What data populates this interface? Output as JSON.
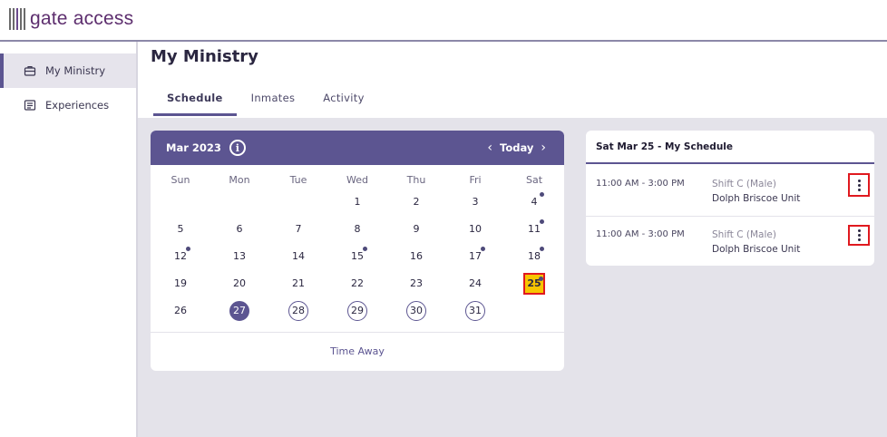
{
  "brand": {
    "name": "gate access"
  },
  "sidebar": {
    "items": [
      {
        "label": "My Ministry",
        "icon": "briefcase-icon",
        "active": true
      },
      {
        "label": "Experiences",
        "icon": "list-icon",
        "active": false
      }
    ]
  },
  "page": {
    "title": "My Ministry"
  },
  "tabs": [
    {
      "label": "Schedule",
      "active": true
    },
    {
      "label": "Inmates",
      "active": false
    },
    {
      "label": "Activity",
      "active": false
    }
  ],
  "calendar": {
    "month_label": "Mar 2023",
    "today_label": "Today",
    "weekdays": [
      "Sun",
      "Mon",
      "Tue",
      "Wed",
      "Thu",
      "Fri",
      "Sat"
    ],
    "weeks": [
      [
        "",
        "",
        "",
        "1",
        "2",
        "3",
        "4"
      ],
      [
        "5",
        "6",
        "7",
        "8",
        "9",
        "10",
        "11"
      ],
      [
        "12",
        "13",
        "14",
        "15",
        "16",
        "17",
        "18"
      ],
      [
        "19",
        "20",
        "21",
        "22",
        "23",
        "24",
        "25"
      ],
      [
        "26",
        "27",
        "28",
        "29",
        "30",
        "31",
        ""
      ]
    ],
    "event_days": [
      "4",
      "11",
      "12",
      "15",
      "17",
      "18",
      "25"
    ],
    "today_day": "27",
    "circled_days": [
      "28",
      "29",
      "30",
      "31"
    ],
    "selected_day": "25",
    "footer_label": "Time Away",
    "colors": {
      "header": "#5c5591",
      "selected_fill": "#f7c500",
      "selected_border": "#e0191f"
    }
  },
  "schedule": {
    "title": "Sat Mar 25 - My Schedule",
    "entries": [
      {
        "time": "11:00 AM - 3:00 PM",
        "shift": "Shift C (Male)",
        "unit": "Dolph Briscoe Unit"
      },
      {
        "time": "11:00 AM - 3:00 PM",
        "shift": "Shift C (Male)",
        "unit": "Dolph Briscoe Unit"
      }
    ]
  }
}
